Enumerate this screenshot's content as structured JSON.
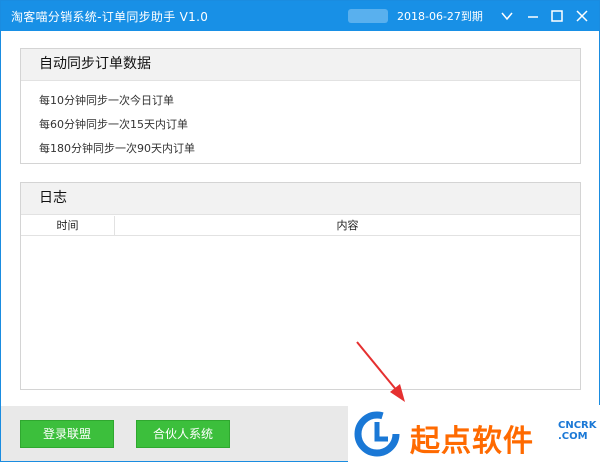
{
  "window": {
    "title": "淘客喵分销系统-订单同步助手 V1.0",
    "expiry": "2018-06-27到期"
  },
  "controls": {
    "dropdown_icon": "chevron-down-icon",
    "minimize_icon": "minimize-icon",
    "maximize_icon": "maximize-icon",
    "close_icon": "close-icon"
  },
  "sync_panel": {
    "title": "自动同步订单数据",
    "lines": [
      "每10分钟同步一次今日订单",
      "每60分钟同步一次15天内订单",
      "每180分钟同步一次90天内订单"
    ]
  },
  "log_panel": {
    "title": "日志",
    "columns": [
      "时间",
      "内容"
    ],
    "rows": []
  },
  "footer": {
    "login_button": "登录联盟",
    "partner_button": "合伙人系统"
  },
  "watermark": {
    "logo_text": "起点软件",
    "site_line1": "CNCRK",
    "site_line2": ".COM"
  },
  "colors": {
    "titlebar": "#1890e6",
    "button": "#3cbf3c",
    "watermark_text": "#ff6a00",
    "annotation_arrow": "#e53030"
  }
}
